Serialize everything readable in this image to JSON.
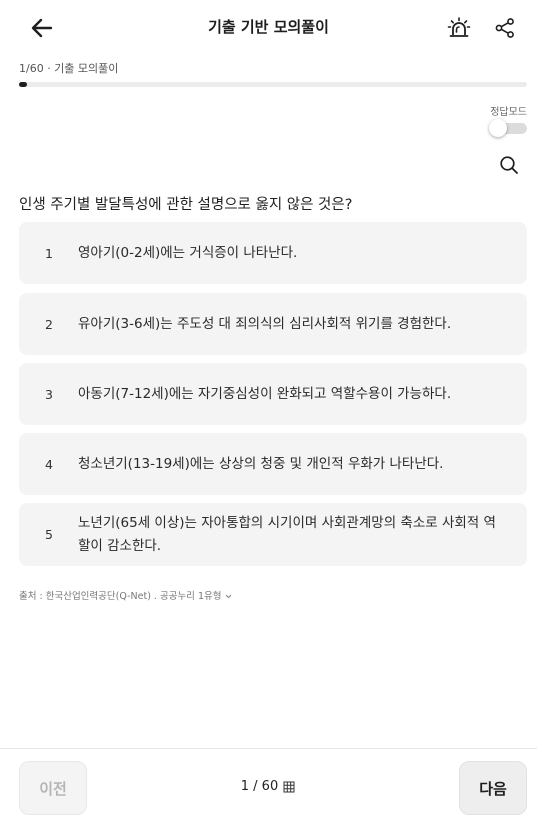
{
  "header": {
    "title": "기출 기반 모의풀이",
    "back_icon": "arrow-left-icon",
    "alarm_icon": "siren-icon",
    "share_icon": "share-icon"
  },
  "progress": {
    "label": "1/60 · 기출 모의풀이",
    "fraction": 0.0167,
    "fill_color": "#1e1e1e"
  },
  "answer_mode": {
    "label": "정답모드",
    "enabled": false
  },
  "question": {
    "text": "인생 주기별 발달특성에 관한 설명으로 옳지 않은 것은?"
  },
  "options": [
    {
      "number": "1",
      "text": "영아기(0-2세)에는 거식증이 나타난다."
    },
    {
      "number": "2",
      "text": "유아기(3-6세)는 주도성 대 죄의식의 심리사회적 위기를 경험한다."
    },
    {
      "number": "3",
      "text": "아동기(7-12세)에는 자기중심성이 완화되고 역할수용이 가능하다."
    },
    {
      "number": "4",
      "text": "청소년기(13-19세)에는 상상의 청중 및 개인적 우화가 나타난다."
    },
    {
      "number": "5",
      "text": "노년기(65세 이상)는 자아통합의 시기이며 사회관계망의 축소로 사회적 역할이 감소한다."
    }
  ],
  "source": {
    "text": "출처 : 한국산업인력공단(Q-Net) . 공공누리 1유형"
  },
  "footer": {
    "prev_label": "이전",
    "page_text": "1 / 60",
    "next_label": "다음"
  }
}
